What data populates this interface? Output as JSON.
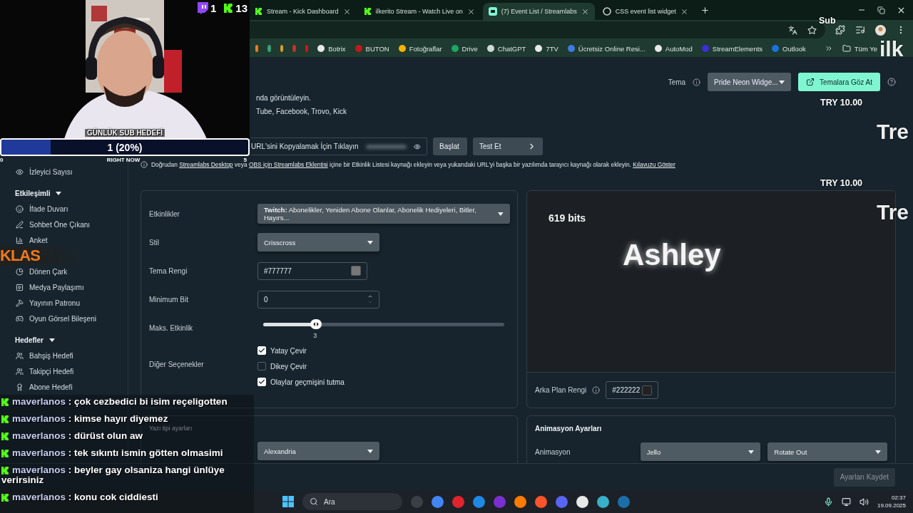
{
  "overlay": {
    "counts": [
      {
        "kind": "twitch",
        "value": "1"
      },
      {
        "kind": "kick",
        "value": "13"
      }
    ],
    "goal": {
      "title": "GÜNLÜK SUB HEDEFİ",
      "value": "1 (20%)",
      "level": 0.2,
      "start": "0",
      "middle": "RIGHT NOW",
      "end": "5"
    },
    "side_texts": [
      {
        "kind": "small",
        "text": "Sub"
      },
      {
        "kind": "big",
        "text": "ilk"
      },
      {
        "kind": "small",
        "text": "TRY 10.00"
      },
      {
        "kind": "big",
        "text": "Tre"
      },
      {
        "kind": "small",
        "text": "TRY 10.00"
      },
      {
        "kind": "big",
        "text": "Tre"
      }
    ],
    "chat": [
      {
        "user": "maverlanos",
        "message": ": çok cezbedici bi isim reçeligotten"
      },
      {
        "user": "maverlanos",
        "message": ": kimse hayır diyemez"
      },
      {
        "user": "maverlanos",
        "message": ": dürüst olun aw"
      },
      {
        "user": "maverlanos",
        "message": ": tek sıkıntı ismin götten olmasimi"
      },
      {
        "user": "maverlanos",
        "message": ": beyler gay olsaniza hangi ünlüye verirsiniz"
      },
      {
        "user": "maverlanos",
        "message": ": konu cok ciddiesti"
      }
    ]
  },
  "browser": {
    "tabs": [
      {
        "title": "Stream - Kick Dashboard",
        "kind": "kick",
        "selected": false
      },
      {
        "title": "ilkerito Stream - Watch Live on",
        "kind": "kick",
        "selected": false
      },
      {
        "title": "(7) Event List / Streamlabs",
        "kind": "streamlabs",
        "selected": true
      },
      {
        "title": "CSS event list widget",
        "kind": "chatgpt",
        "selected": false
      }
    ],
    "bookmarks": [
      {
        "label": "Botrix",
        "color": "#e8e8e8"
      },
      {
        "label": "BUTON",
        "color": "#c21a1a"
      },
      {
        "label": "Fotoğraflar",
        "color": "#f4b400"
      },
      {
        "label": "Drive",
        "color": "#1fa463"
      },
      {
        "label": "ChatGPT",
        "color": "#cfd8d4"
      },
      {
        "label": "7TV",
        "color": "#e8e8e8"
      },
      {
        "label": "Ücretsiz Online Resi...",
        "color": "#3d7be0"
      },
      {
        "label": "AutoMod",
        "color": "#e8e8e8"
      },
      {
        "label": "StreamElements",
        "color": "#3b2fd6"
      },
      {
        "label": "Outlook",
        "color": "#1a73d9"
      }
    ],
    "folder": "Tüm Ye"
  },
  "sidebar": [
    {
      "kind": "item",
      "label": "İzleyici Sayısı"
    },
    {
      "kind": "header",
      "label": "Etkileşimli",
      "expanded": true
    },
    {
      "kind": "item",
      "label": "İfade Duvarı"
    },
    {
      "kind": "item",
      "label": "Sohbet Öne Çıkanı"
    },
    {
      "kind": "item",
      "label": "Anket"
    },
    {
      "kind": "covered",
      "label": "KLAS"
    },
    {
      "kind": "item",
      "label": "Dönen Çark"
    },
    {
      "kind": "item",
      "label": "Medya Paylaşımı"
    },
    {
      "kind": "item",
      "label": "Yayının Patronu"
    },
    {
      "kind": "item",
      "label": "Oyun Görsel Bileşeni"
    },
    {
      "kind": "header",
      "label": "Hedefler",
      "expanded": true
    },
    {
      "kind": "item",
      "label": "Bahşiş Hedefi"
    },
    {
      "kind": "item",
      "label": "Takipçi Hedefi"
    },
    {
      "kind": "item",
      "label": "Abone Hedefi"
    }
  ],
  "header": {
    "theme_label": "Tema",
    "theme_value": "Pride Neon Widge...",
    "browse_button": "Temalara Göz At"
  },
  "description": [
    "nda görüntüleyin.",
    "Tube, Facebook, Trovo, Kick"
  ],
  "url_row": {
    "field": "URL'sini Kopyalamak İçin Tıklayın",
    "start_button": "Başlat",
    "test_button": "Test Et"
  },
  "info": [
    {
      "text": "Doğrudan ",
      "kind": "text"
    },
    {
      "text": "Streamlabs Desktop",
      "kind": "link"
    },
    {
      "text": " veya ",
      "kind": "text"
    },
    {
      "text": "OBS için Streamlabs Eklentisi",
      "kind": "link"
    },
    {
      "text": " içine bir Etkinlik Listesi kaynağı ekleyin veya yukarıdaki URL'yi başka bir yazılımda tarayıcı kaynağı olarak ekleyin. ",
      "kind": "text"
    },
    {
      "text": "Kılavuzu Göster",
      "kind": "link"
    }
  ],
  "settings": [
    {
      "kind": "select",
      "label": "Etkinlikler",
      "value": "**Twitch:** Abonelikler, Yeniden Abone Olanlar, Abonelik Hediyeleri, Bitler, Hayırs..."
    },
    {
      "kind": "select",
      "label": "Stil",
      "value": "Crisscross"
    },
    {
      "kind": "color",
      "label": "Tema Rengi",
      "value": "#777777"
    },
    {
      "kind": "number",
      "label": "Minimum Bit",
      "value": "0"
    },
    {
      "kind": "slider",
      "label": "Maks. Etkinlik",
      "level": 0.22,
      "reading": "3"
    },
    {
      "kind": "checks",
      "label": "Diğer Seçenekler",
      "options": [
        {
          "label": "Yatay Çevir",
          "checked": true
        },
        {
          "label": "Dikey Çevir",
          "checked": false
        },
        {
          "label": "Olaylar geçmişini tutma",
          "checked": true
        }
      ]
    }
  ],
  "preview": {
    "amount": "619 bits",
    "name": "Ashley",
    "bg_label": "Arka Plan Rengi",
    "bg_value": "#222222"
  },
  "font_card": {
    "label": "Yazı tipi ayarları",
    "value": "Alexandria"
  },
  "animation_card": {
    "title": "Animasyon Ayarları",
    "label": "Animasyon",
    "in_value": "Jello",
    "out_value": "Rotate Out"
  },
  "save_button": {
    "label": "Ayarları Kaydet",
    "disabled": true
  },
  "taskbar": {
    "search": "Ara",
    "time": "02:37",
    "date": "19.09.2025"
  }
}
